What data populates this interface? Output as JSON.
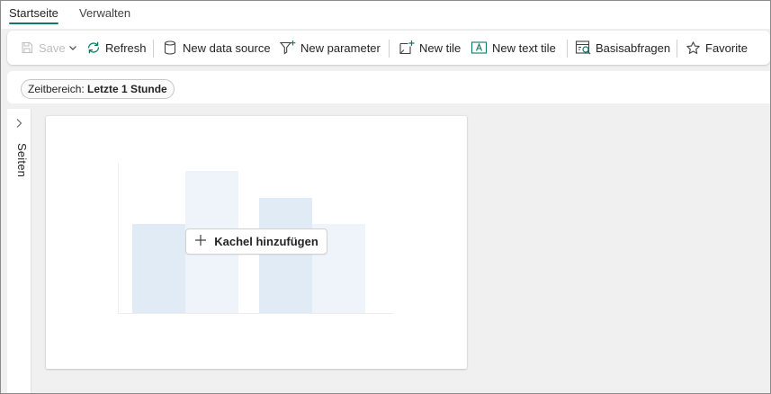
{
  "tabs": [
    {
      "label": "Startseite",
      "active": true
    },
    {
      "label": "Verwalten",
      "active": false
    }
  ],
  "toolbar": {
    "save_label": "Save",
    "refresh_label": "Refresh",
    "new_data_source_label": "New data source",
    "new_parameter_label": "New parameter",
    "new_tile_label": "New tile",
    "new_text_tile_label": "New text tile",
    "base_queries_label": "Basisabfragen",
    "favorite_label": "Favorite"
  },
  "filters": {
    "time_range_label": "Zeitbereich:",
    "time_range_value": "Letzte 1 Stunde"
  },
  "pages_pane": {
    "label": "Seiten"
  },
  "canvas": {
    "add_tile_label": "Kachel hinzufügen"
  },
  "colors": {
    "accent": "#117865",
    "placeholder_bar_dark": "#e1ebf6",
    "placeholder_bar_light": "#eff4fb",
    "page_background": "#f0f0f0"
  },
  "icons": {
    "save": "save-icon",
    "dropdown": "chevron-down-icon",
    "refresh": "refresh-icon",
    "data_source": "database-icon",
    "parameter": "filter-add-icon",
    "tile": "tile-add-icon",
    "text_tile": "text-box-icon",
    "queries": "query-icon",
    "favorite": "star-icon",
    "pages_toggle": "chevron-right-icon",
    "add": "plus-icon"
  }
}
